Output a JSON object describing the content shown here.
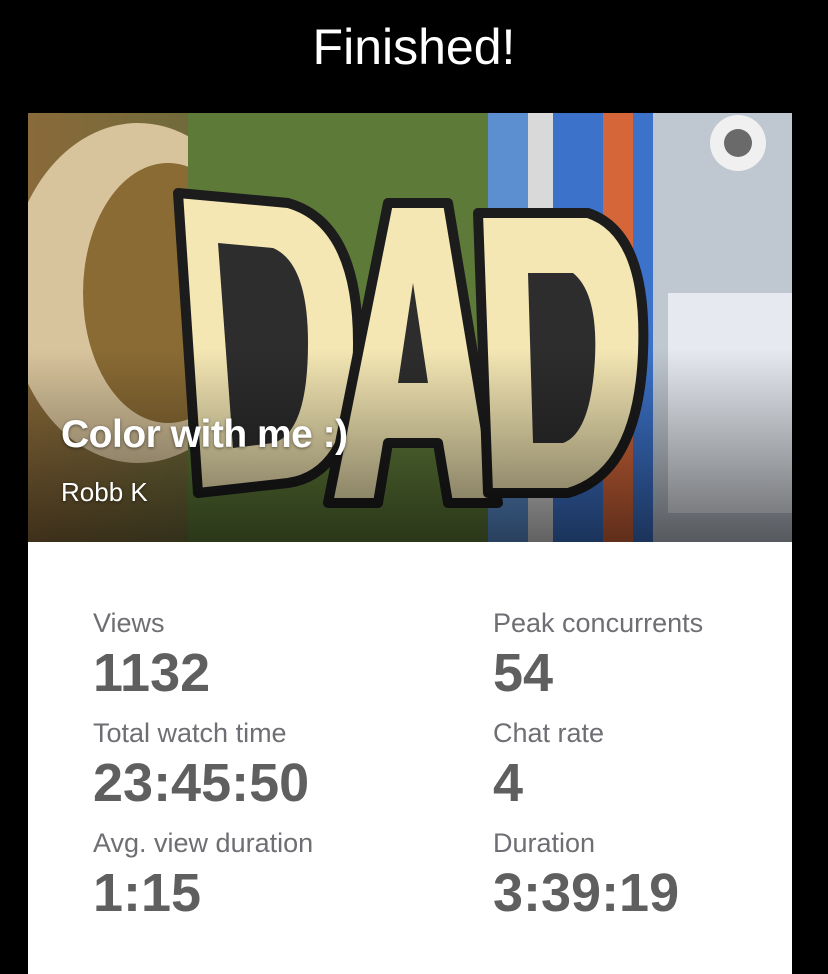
{
  "header": {
    "title": "Finished!"
  },
  "video": {
    "title": "Color with me :)",
    "author": "Robb K",
    "thumbnail_text": "DAD"
  },
  "stats": {
    "views": {
      "label": "Views",
      "value": "1132"
    },
    "peak_concurrents": {
      "label": "Peak concurrents",
      "value": "54"
    },
    "total_watch_time": {
      "label": "Total watch time",
      "value": "23:45:50"
    },
    "chat_rate": {
      "label": "Chat rate",
      "value": "4"
    },
    "avg_view_duration": {
      "label": "Avg. view duration",
      "value": "1:15"
    },
    "duration": {
      "label": "Duration",
      "value": "3:39:19"
    }
  }
}
